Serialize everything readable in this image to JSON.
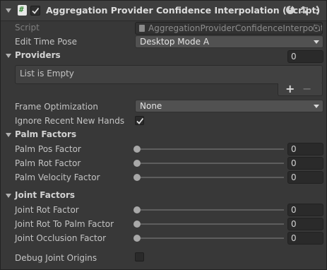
{
  "component": {
    "title": "Aggregation Provider Confidence Interpolation (Script)",
    "enabled": true
  },
  "script_field": {
    "label": "Script",
    "value": "AggregationProviderConfidenceInterpolat"
  },
  "edit_time_pose": {
    "label": "Edit Time Pose",
    "value": "Desktop Mode A"
  },
  "providers": {
    "label": "Providers",
    "count": "0",
    "empty_text": "List is Empty",
    "add_label": "+",
    "remove_label": "−"
  },
  "frame_optimization": {
    "label": "Frame Optimization",
    "value": "None"
  },
  "ignore_recent_new_hands": {
    "label": "Ignore Recent New Hands",
    "checked": true
  },
  "palm_factors": {
    "header": "Palm Factors",
    "items": [
      {
        "label": "Palm Pos Factor",
        "value": "0",
        "fraction": 0
      },
      {
        "label": "Palm Rot Factor",
        "value": "0",
        "fraction": 0
      },
      {
        "label": "Palm Velocity Factor",
        "value": "0",
        "fraction": 0
      }
    ]
  },
  "joint_factors": {
    "header": "Joint Factors",
    "items": [
      {
        "label": "Joint Rot Factor",
        "value": "0",
        "fraction": 0
      },
      {
        "label": "Joint Rot To Palm Factor",
        "value": "0",
        "fraction": 0
      },
      {
        "label": "Joint Occlusion Factor",
        "value": "0",
        "fraction": 0
      }
    ]
  },
  "debug_joint_origins": {
    "label": "Debug Joint Origins",
    "checked": false
  },
  "icons": [
    "foldout-arrow-icon",
    "script-icon",
    "enable-checkbox",
    "help-icon",
    "presets-icon",
    "kebab-menu-icon",
    "object-picker-icon",
    "dropdown-arrow-icon",
    "checkmark-icon",
    "slider-thumb-icon"
  ],
  "colors": {
    "background": "#383838",
    "header": "#3e3e3e",
    "field": "#2a2a2a",
    "dropdown": "#515151",
    "text": "#c4c4c4"
  }
}
